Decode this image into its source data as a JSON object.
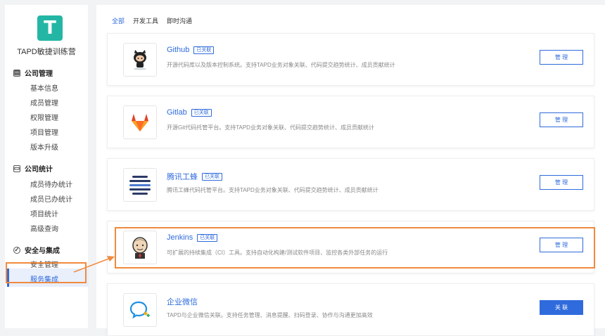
{
  "sidebar": {
    "logo_letter": "T",
    "org_name": "TAPD敏捷训练营",
    "sections": [
      {
        "title": "公司管理",
        "icon": "building-icon",
        "items": [
          "基本信息",
          "成员管理",
          "权限管理",
          "项目管理",
          "版本升级"
        ]
      },
      {
        "title": "公司统计",
        "icon": "calendar-icon",
        "items": [
          "成员待办统计",
          "成员已办统计",
          "项目统计",
          "高级查询"
        ]
      },
      {
        "title": "安全与集成",
        "icon": "shield-icon",
        "items": [
          "安全管理",
          "服务集成"
        ]
      }
    ],
    "active_item": "服务集成"
  },
  "tabs": [
    {
      "label": "全部",
      "active": true
    },
    {
      "label": "开发工具",
      "active": false
    },
    {
      "label": "即时沟通",
      "active": false
    }
  ],
  "integrations": [
    {
      "name": "Github",
      "badge": "已关联",
      "desc": "开源代码库以及版本控制系统。支持TAPD业务对象关联、代码提交趋势统计、成员贡献统计",
      "button": "管 理",
      "icon": "github-octocat-icon"
    },
    {
      "name": "Gitlab",
      "badge": "已关联",
      "desc": "开源Git代码托管平台。支持TAPD业务对象关联、代码提交趋势统计、成员贡献统计",
      "button": "管 理",
      "icon": "gitlab-fox-icon"
    },
    {
      "name": "腾讯工蜂",
      "badge": "已关联",
      "desc": "腾讯工蜂代码托管平台。支持TAPD业务对象关联、代码提交趋势统计、成员贡献统计",
      "button": "管 理",
      "icon": "tencent-gongfeng-icon"
    },
    {
      "name": "Jenkins",
      "badge": "已关联",
      "desc": "可扩展的持续集成（CI）工具。支持自动化构建/测试软件项目、监控各类外部任务的运行",
      "button": "管 理",
      "icon": "jenkins-butler-icon"
    },
    {
      "name": "企业微信",
      "badge": "",
      "desc": "TAPD与企业微信关联。支持任务管理、消息提醒、扫码登录、协作与沟通更加高效",
      "button": "关 联",
      "icon": "wecom-icon"
    }
  ],
  "colors": {
    "accent": "#2f6bdc",
    "highlight": "#f08a3e",
    "logo": "#23b6a5"
  }
}
